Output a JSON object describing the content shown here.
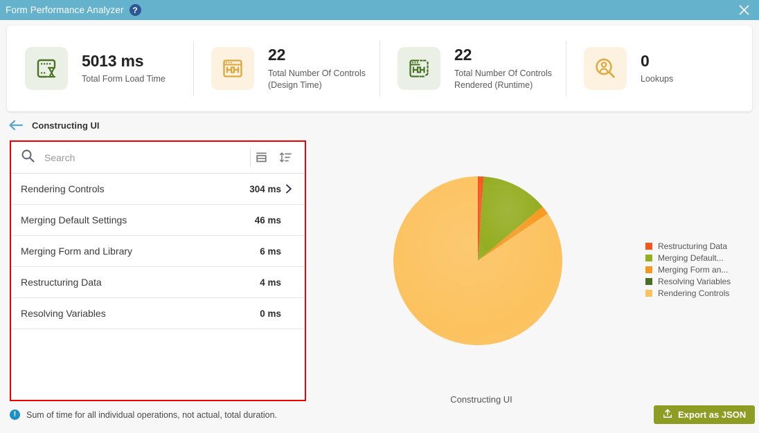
{
  "titlebar": {
    "title": "Form Performance Analyzer",
    "help_label": "?",
    "close_label": "✕",
    "background": "#65b2cd",
    "help_background": "#2c5697"
  },
  "stats": [
    {
      "value": "5013 ms",
      "label": "Total Form Load Time",
      "icon": "form-load-time-icon",
      "icon_theme": "green",
      "icon_color": "#4b7427"
    },
    {
      "value": "22",
      "label": "Total Number Of Controls (Design Time)",
      "icon": "controls-design-time-icon",
      "icon_theme": "amber",
      "icon_color": "#dea73a"
    },
    {
      "value": "22",
      "label": "Total Number Of Controls Rendered (Runtime)",
      "icon": "controls-runtime-icon",
      "icon_theme": "green",
      "icon_color": "#4b7427"
    },
    {
      "value": "0",
      "label": "Lookups",
      "icon": "lookups-icon",
      "icon_theme": "amber",
      "icon_color": "#dea73a"
    }
  ],
  "breadcrumb": {
    "back_label": "back-arrow",
    "label": "Constructing UI",
    "arrow_color": "#5aa9c8"
  },
  "list_panel": {
    "search": {
      "placeholder": "Search",
      "value": ""
    },
    "tools": [
      {
        "name": "group-collapse-icon",
        "title": "Group"
      },
      {
        "name": "sort-icon",
        "title": "Sort"
      }
    ],
    "rows": [
      {
        "name": "Rendering Controls",
        "value": "304 ms",
        "has_chevron": true
      },
      {
        "name": "Merging Default Settings",
        "value": "46 ms",
        "has_chevron": false
      },
      {
        "name": "Merging Form and Library",
        "value": "6 ms",
        "has_chevron": false
      },
      {
        "name": "Restructuring Data",
        "value": "4 ms",
        "has_chevron": false
      },
      {
        "name": "Resolving Variables",
        "value": "0 ms",
        "has_chevron": false
      }
    ],
    "highlight_color": "#ee0000"
  },
  "chart_data": {
    "type": "pie",
    "title": "",
    "caption": "Constructing UI",
    "start_angle": 0,
    "unit": "ms",
    "total": 360,
    "categories": [
      "Restructuring Data",
      "Merging Default Settings",
      "Merging Form and Library",
      "Resolving Variables",
      "Rendering Controls"
    ],
    "values": [
      4,
      46,
      6,
      0,
      304
    ],
    "colors": [
      "#f4561e",
      "#95ad21",
      "#f59a21",
      "#4a7023",
      "#fcc25f"
    ],
    "legend": [
      {
        "label": "Restructuring Data",
        "color": "#f4561e"
      },
      {
        "label": "Merging Default...",
        "color": "#95ad21"
      },
      {
        "label": "Merging Form an...",
        "color": "#f59a21"
      },
      {
        "label": "Resolving Variables",
        "color": "#4a7023"
      },
      {
        "label": "Rendering Controls",
        "color": "#fcc25f"
      }
    ],
    "legend_position": "right"
  },
  "footer": {
    "info_label": "!",
    "note": "Sum of time for all individual operations, not actual, total duration.",
    "export_label": "Export as JSON",
    "export_color": "#8d9c22"
  }
}
